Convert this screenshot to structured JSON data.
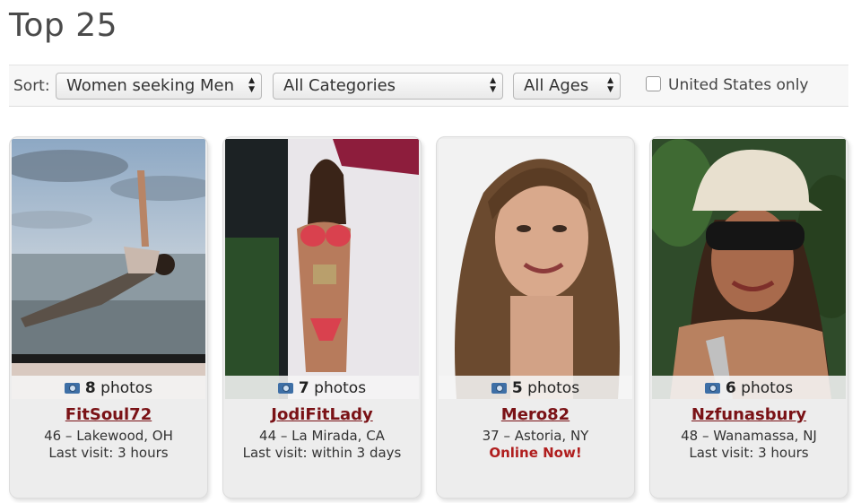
{
  "page_title": "Top 25",
  "filters": {
    "sort_label": "Sort:",
    "seeking": "Women seeking Men",
    "category": "All Categories",
    "ages": "All Ages",
    "us_only_label": "United States only",
    "us_only_checked": false
  },
  "profiles": [
    {
      "photos_count": "8",
      "photos_label": "photos",
      "username": "FitSoul72",
      "location": "46 – Lakewood, OH",
      "status": "Last visit: 3 hours"
    },
    {
      "photos_count": "7",
      "photos_label": "photos",
      "username": "JodiFitLady",
      "location": "44 – La Mirada, CA",
      "status": "Last visit: within 3 days"
    },
    {
      "photos_count": "5",
      "photos_label": "photos",
      "username": "Mero82",
      "location": "37 – Astoria, NY",
      "status": "Online Now!"
    },
    {
      "photos_count": "6",
      "photos_label": "photos",
      "username": "Nzfunasbury",
      "location": "48 – Wanamassa, NJ",
      "status": "Last visit: 3 hours"
    }
  ],
  "colors": {
    "username": "#7a1216",
    "online": "#b01e1e",
    "camera_icon": "#3e6fa6"
  }
}
